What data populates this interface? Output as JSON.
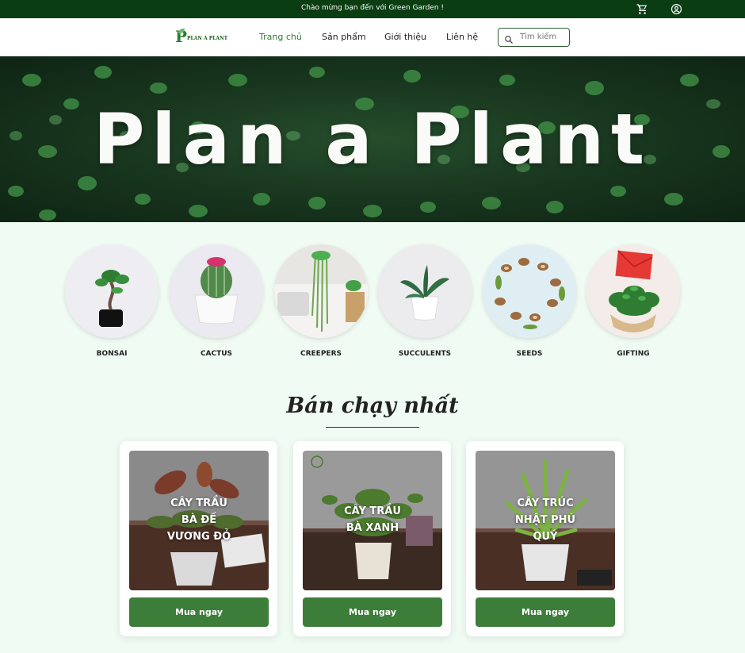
{
  "topbar": {
    "message": "Chào mừng bạn đến với Green Garden !",
    "icons": [
      "cart-icon",
      "user-account-icon"
    ]
  },
  "nav": {
    "logo_text": "PLAN A PLANT",
    "links": [
      "Trang chủ",
      "Sản phẩm",
      "Giới thiệu",
      "Liên hệ"
    ],
    "active": "Trang chủ",
    "search_placeholder": "Tìm kiếm"
  },
  "hero": {
    "title": "Plan a Plant"
  },
  "categories": [
    "BONSAI",
    "CACTUS",
    "CREEPERS",
    "SUCCULENTS",
    "SEEDS",
    "GIFTING"
  ],
  "bestsellers": {
    "title": "Bán chạy nhất",
    "products": [
      {
        "name_lines": [
          "CÂY TRẦU",
          "BÀ ĐẾ",
          "VƯƠNG ĐỎ"
        ],
        "button": "Mua ngay"
      },
      {
        "name_lines": [
          "CÂY TRẦU",
          "BÀ XANH"
        ],
        "button": "Mua ngay"
      },
      {
        "name_lines": [
          "CÂY TRÚC",
          "NHẬT PHÚ",
          "QUÝ"
        ],
        "button": "Mua ngay"
      }
    ]
  },
  "colors": {
    "topbar": "#0a3d12",
    "accent": "#2e7d32",
    "button": "#3d7d3a",
    "page_bg": "#f0fbf3"
  }
}
